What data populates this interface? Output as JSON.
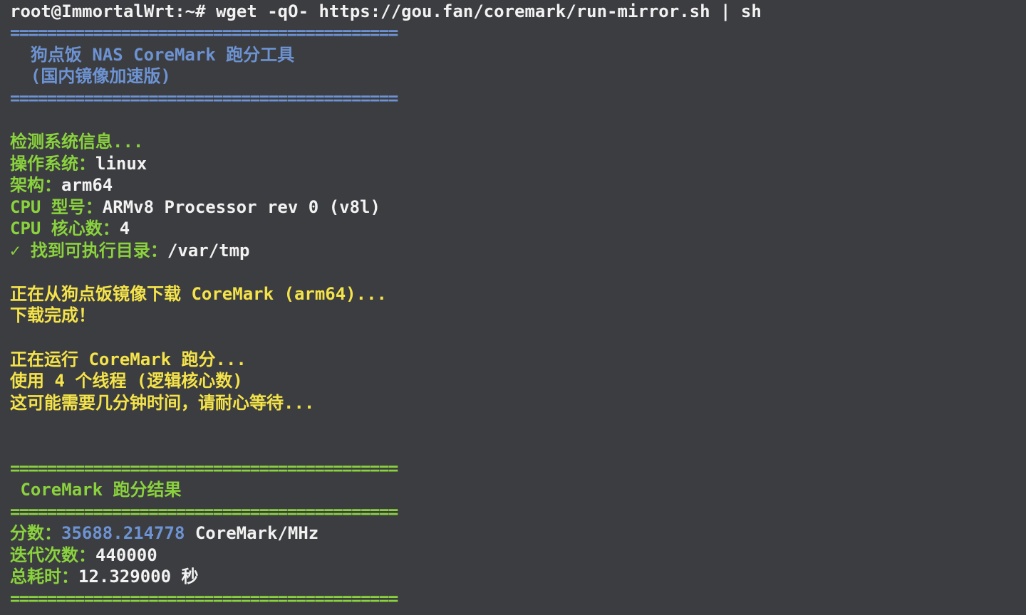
{
  "colors": {
    "background": "#3c3d40",
    "text": "#f2f2f2",
    "blue": "#6d93d3",
    "green": "#8ad23e",
    "yellow": "#f4e34a"
  },
  "prompt": {
    "text": "root@ImmortalWrt:~# wget -qO- https://gou.fan/coremark/run-mirror.sh | sh"
  },
  "header": {
    "separator": "==========================================",
    "title": "  狗点饭 NAS CoreMark 跑分工具",
    "subtitle": "  (国内镜像加速版)"
  },
  "sysinfo": {
    "detecting": "检测系统信息...",
    "os_label": "操作系统：",
    "os_value": "linux",
    "arch_label": "架构：",
    "arch_value": "arm64",
    "cpu_model_label": "CPU 型号：",
    "cpu_model_value": "ARMv8 Processor rev 0 (v8l)",
    "cpu_cores_label": "CPU 核心数：",
    "cpu_cores_value": "4",
    "exec_dir_label": "✓ 找到可执行目录：",
    "exec_dir_value": "/var/tmp"
  },
  "download": {
    "downloading": "正在从狗点饭镜像下载 CoreMark (arm64)...",
    "done": "下载完成！"
  },
  "run": {
    "running": "正在运行 CoreMark 跑分...",
    "threads": "使用 4 个线程 (逻辑核心数)",
    "wait": "这可能需要几分钟时间，请耐心等待..."
  },
  "results": {
    "separator": "==========================================",
    "title": " CoreMark 跑分结果",
    "score_label": "分数：",
    "score_value": "35688.214778",
    "score_unit": " CoreMark/MHz",
    "iterations_label": "迭代次数：",
    "iterations_value": "440000",
    "time_label": "总耗时：",
    "time_value": "12.329000 秒"
  }
}
